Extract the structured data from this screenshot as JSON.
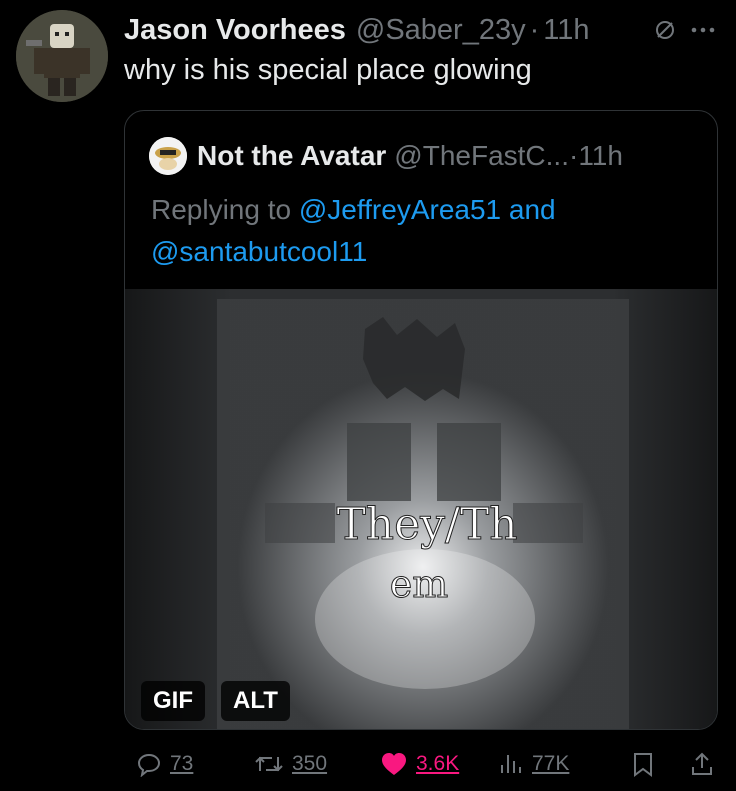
{
  "author": {
    "name": "Jason Voorhees",
    "handle": "@Saber_23y",
    "separator": "·",
    "time": "11h"
  },
  "tweet": {
    "text": "why is his special place glowing"
  },
  "quote": {
    "name": "Not the Avatar",
    "handle": "@TheFastC...",
    "separator": "·",
    "time": "11h",
    "replying_prefix": "Replying to",
    "mention_1": "@JeffreyArea51",
    "conjunction": "and",
    "mention_2": "@santabutcool11",
    "media": {
      "caption_line1": "They/Th",
      "caption_line2": "em",
      "badge_gif": "GIF",
      "badge_alt": "ALT"
    }
  },
  "actions": {
    "replies": "73",
    "reposts": "350",
    "likes": "3.6K",
    "views": "77K"
  },
  "colors": {
    "background": "#000000",
    "text_primary": "#e7e9ea",
    "text_secondary": "#71767b",
    "link": "#1d9bf0",
    "like": "#f91880",
    "border": "#2f3336"
  },
  "icons": [
    "avatar-image",
    "mute-icon",
    "more-icon",
    "reply-icon",
    "repost-icon",
    "like-icon",
    "views-icon",
    "bookmark-icon",
    "share-icon"
  ]
}
